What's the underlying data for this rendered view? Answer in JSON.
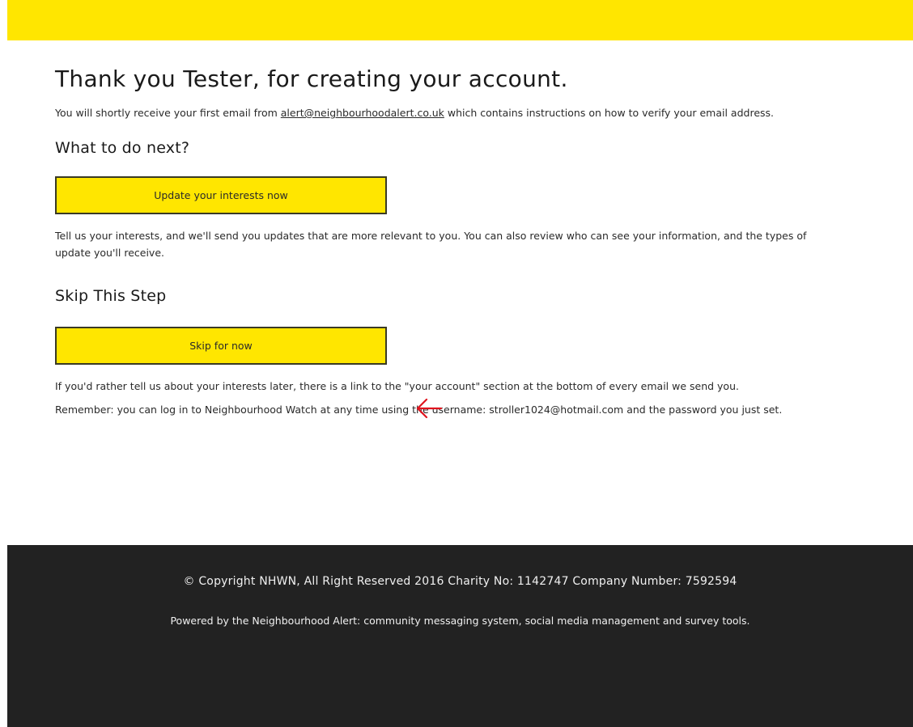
{
  "header": {
    "bar_color": "#ffe600"
  },
  "main": {
    "title": "Thank you Tester, for creating your account.",
    "intro_before": "You will shortly receive your first email from ",
    "intro_email": "alert@neighbourhoodalert.co.uk",
    "intro_after": " which contains instructions on how to verify your email address.",
    "next_heading": "What to do next?",
    "update_button": "Update your interests now",
    "update_text": "Tell us your interests, and we'll send you updates that are more relevant to you. You can also review who can see your information, and the types of update you'll receive.",
    "skip_heading": "Skip This Step",
    "skip_button": "Skip for now",
    "skip_text": "If you'd rather tell us about your interests later, there is a link to the \"your account\" section at the bottom of every email we send you.",
    "remember_text": "Remember: you can log in to Neighbourhood Watch at any time using the username: stroller1024@hotmail.com and the password you just set."
  },
  "annotation": {
    "icon": "arrow-left-icon",
    "color": "#e0141e"
  },
  "footer": {
    "copyright": "© Copyright NHWN, All Right Reserved 2016 Charity No: 1142747 Company Number: 7592594",
    "powered": "Powered by the Neighbourhood Alert: community messaging system, social media management and survey tools.",
    "background": "#222222"
  }
}
